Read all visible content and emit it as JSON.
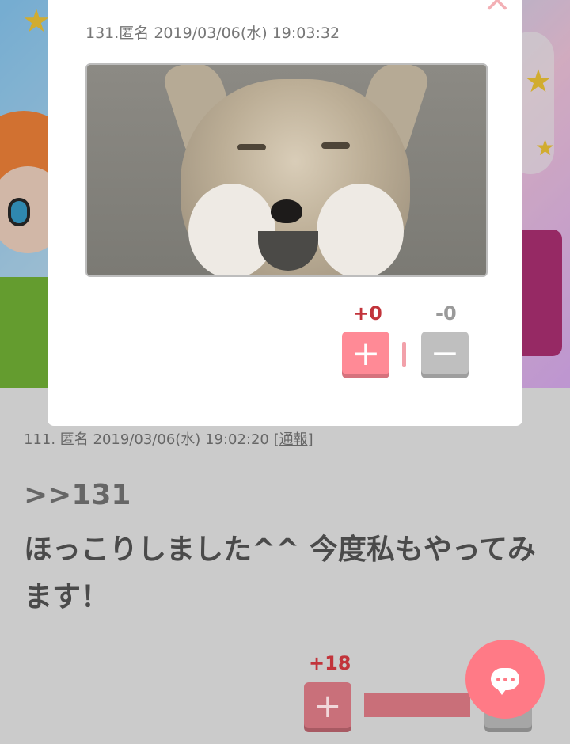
{
  "modal": {
    "close_icon": "×",
    "meta": "131.匿名 2019/03/06(水) 19:03:32",
    "vote": {
      "plus_count": "+0",
      "minus_count": "-0",
      "plus_icon": "+",
      "minus_icon": "−"
    }
  },
  "comment": {
    "meta_prefix": "111. 匿名 2019/03/06(水) 19:02:20 ",
    "report_label": "[通報]",
    "anchor": ">>131",
    "text": "ほっこりしました^^ 今度私もやってみます！",
    "vote": {
      "plus_count": "+18",
      "plus_icon": "+"
    }
  },
  "fab": {
    "icon": "chat-bubble-icon"
  },
  "colors": {
    "accent": "#ff7a86",
    "plus": "#c2343b",
    "minus": "#9a9a9a"
  }
}
